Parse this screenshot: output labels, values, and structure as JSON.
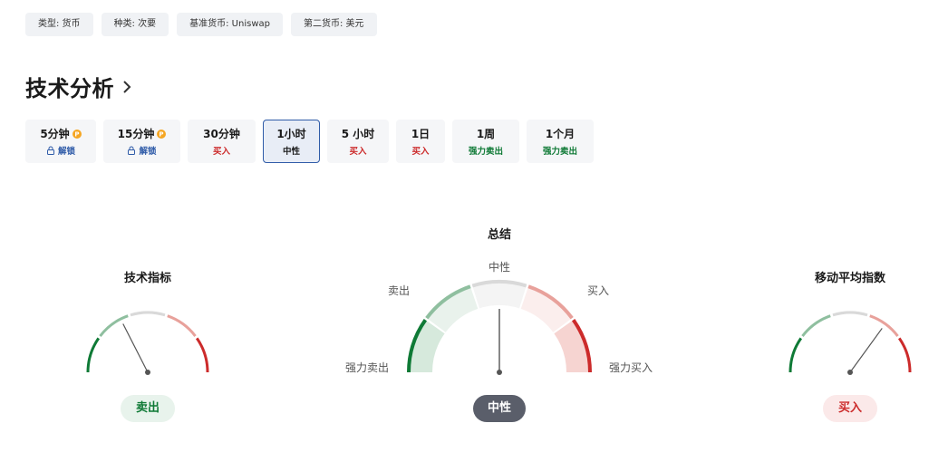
{
  "tags": [
    {
      "label": "类型: 货币"
    },
    {
      "label": "种类: 次要"
    },
    {
      "label": "基准货币: Uniswap"
    },
    {
      "label": "第二货币: 美元"
    }
  ],
  "heading": {
    "title": "技术分析"
  },
  "timeframes": [
    {
      "label": "5分钟",
      "status": "解锁",
      "pro": true,
      "locked": true,
      "tone": "unlock"
    },
    {
      "label": "15分钟",
      "status": "解锁",
      "pro": true,
      "locked": true,
      "tone": "unlock"
    },
    {
      "label": "30分钟",
      "status": "买入",
      "pro": false,
      "locked": false,
      "tone": "buy"
    },
    {
      "label": "1小时",
      "status": "中性",
      "pro": false,
      "locked": false,
      "tone": "neutral",
      "active": true
    },
    {
      "label": "5 小时",
      "status": "买入",
      "pro": false,
      "locked": false,
      "tone": "buy"
    },
    {
      "label": "1日",
      "status": "买入",
      "pro": false,
      "locked": false,
      "tone": "buy"
    },
    {
      "label": "1周",
      "status": "强力卖出",
      "pro": false,
      "locked": false,
      "tone": "strong-sell"
    },
    {
      "label": "1个月",
      "status": "强力卖出",
      "pro": false,
      "locked": false,
      "tone": "strong-sell"
    }
  ],
  "colors": {
    "strong_sell": "#0f7a36",
    "sell": "#8fbf9f",
    "neutral": "#d9d9d9",
    "buy": "#e8a19b",
    "strong_buy": "#cc2b2b",
    "neutral_text": "#1a1a1a",
    "accent": "#2f5ba8"
  },
  "gauges": {
    "technical": {
      "title": "技术指标",
      "result": "卖出",
      "value": -0.3
    },
    "summary": {
      "title": "总结",
      "result": "中性",
      "value": 0,
      "labels": {
        "strong_sell": "强力卖出",
        "sell": "卖出",
        "neutral": "中性",
        "buy": "买入",
        "strong_buy": "强力买入"
      }
    },
    "moving_average": {
      "title": "移动平均指数",
      "result": "买入",
      "value": 0.4
    }
  }
}
